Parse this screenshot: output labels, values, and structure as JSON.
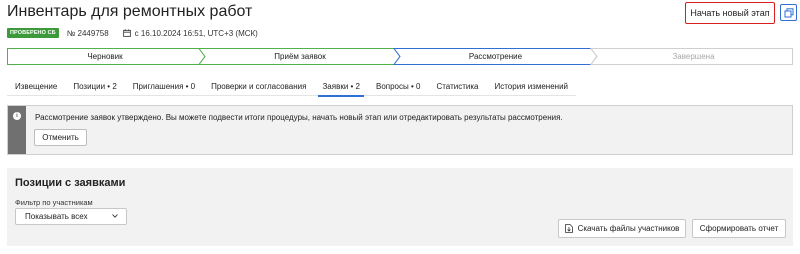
{
  "header": {
    "title": "Инвентарь для ремонтных работ",
    "new_stage_label": "Начать новый этап",
    "copy_icon": "copy-icon"
  },
  "meta": {
    "badge": "ПРОВЕРЕНО СБ",
    "number": "№ 2449758",
    "date": "с 16.10.2024 16:51, UTC+3 (МСК)",
    "date_icon": "calendar-icon"
  },
  "steps": [
    {
      "label": "Черновик",
      "state": "done"
    },
    {
      "label": "Приём заявок",
      "state": "done"
    },
    {
      "label": "Рассмотрение",
      "state": "current"
    },
    {
      "label": "Завершена",
      "state": "pending"
    }
  ],
  "colors": {
    "step_done": "#52b04d",
    "step_current": "#2f6fd6",
    "step_pending": "#cfcfcf",
    "badge": "#3d9a3a",
    "accent": "#2f6fd6",
    "highlight_border": "#d81e1e"
  },
  "tabs": [
    {
      "label": "Извещение",
      "active": false
    },
    {
      "label": "Позиции • 2",
      "active": false
    },
    {
      "label": "Приглашения • 0",
      "active": false
    },
    {
      "label": "Проверки и согласования",
      "active": false
    },
    {
      "label": "Заявки • 2",
      "active": true
    },
    {
      "label": "Вопросы • 0",
      "active": false
    },
    {
      "label": "Статистика",
      "active": false
    },
    {
      "label": "История изменений",
      "active": false
    }
  ],
  "alert": {
    "icon": "info-icon",
    "text": "Рассмотрение заявок утверждено. Вы можете подвести итоги процедуры, начать новый этап или отредактировать результаты рассмотрения.",
    "cancel_label": "Отменить"
  },
  "positions": {
    "title": "Позиции с заявками",
    "filter_label": "Фильтр по участникам",
    "filter_value": "Показывать всех",
    "download_label": "Скачать файлы участников",
    "report_label": "Сформировать отчет"
  }
}
